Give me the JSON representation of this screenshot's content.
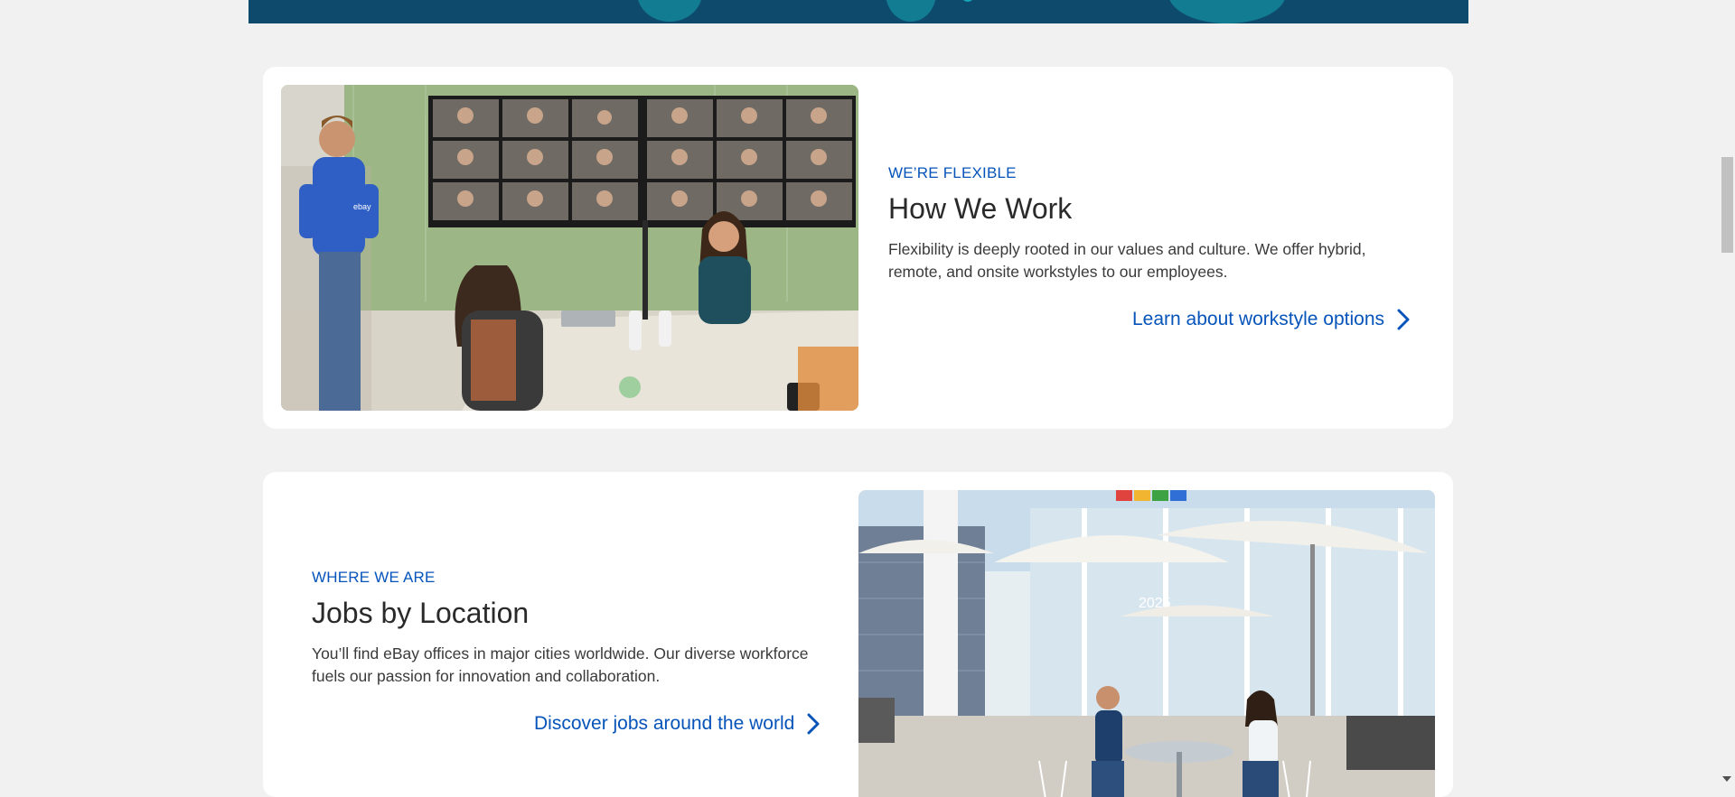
{
  "sections": [
    {
      "eyebrow": "WE’RE FLEXIBLE",
      "heading": "How We Work",
      "body": "Flexibility is deeply rooted in our values and culture. We offer hybrid, remote, and onsite workstyles to our employees.",
      "cta": "Learn about workstyle options",
      "image_alt": "Team meeting with video call participants on screen",
      "image_badge": "ebay"
    },
    {
      "eyebrow": "WHERE WE ARE",
      "heading": "Jobs by Location",
      "body": "You’ll find eBay offices in major cities worldwide. Our diverse workforce fuels our passion for innovation and collaboration.",
      "cta": "Discover jobs around the world",
      "image_alt": "Employees working at an outdoor patio with umbrellas",
      "image_sign": "2025"
    }
  ],
  "colors": {
    "accent": "#0654ba",
    "banner": "#0e4a6b",
    "page_bg": "#f1f1f1"
  },
  "icons": {
    "cta_arrow": "chevron-right-icon"
  }
}
